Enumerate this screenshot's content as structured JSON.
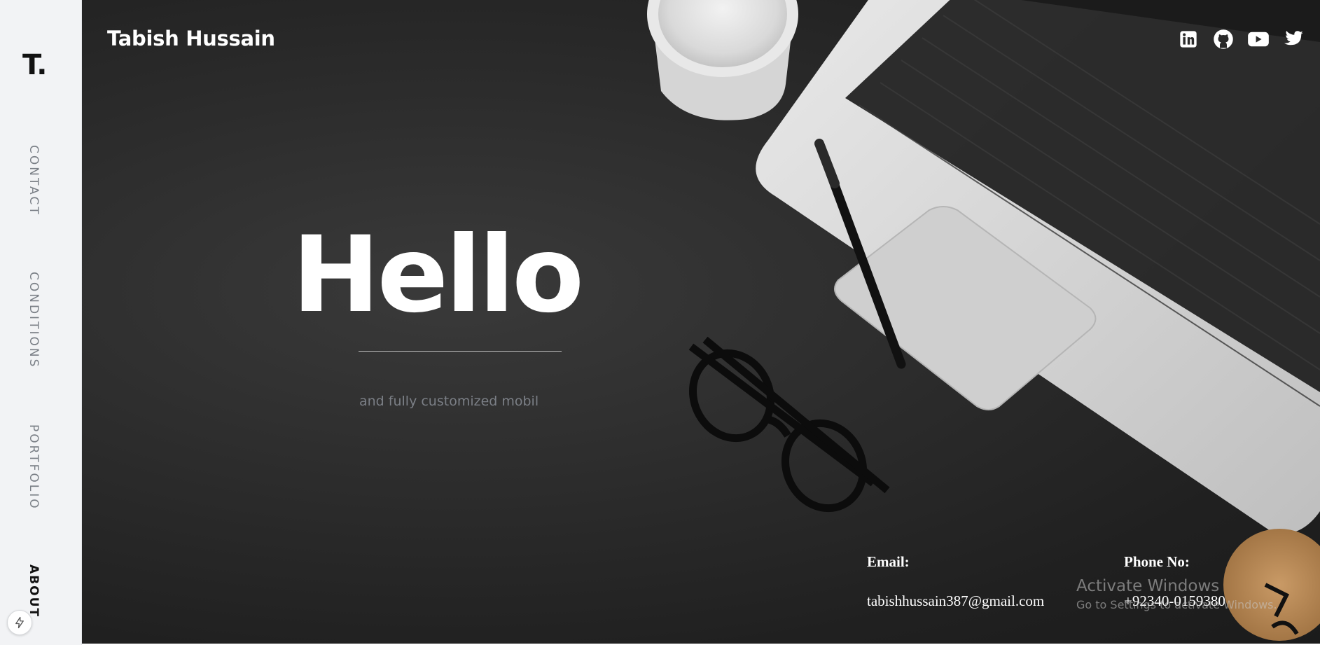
{
  "sidebar": {
    "brand": "T.",
    "nav": [
      {
        "label": "CONTACT",
        "active": false
      },
      {
        "label": "CONDITIONS",
        "active": false
      },
      {
        "label": "PORTFOLIO",
        "active": false
      },
      {
        "label": "ABOUT",
        "active": true
      }
    ],
    "bottom_button_icon": "bolt-icon"
  },
  "header": {
    "site_name": "Tabish Hussain",
    "social_icons": [
      "linkedin-icon",
      "github-icon",
      "youtube-icon",
      "twitter-icon"
    ]
  },
  "hero": {
    "headline": "Hello",
    "subtitle": "and fully customized mobil"
  },
  "contact": {
    "email_label": "Email:",
    "email": "tabishhussain387@gmail.com",
    "phone_label": "Phone No:",
    "phone": "+92340-0159380"
  },
  "overlay": {
    "activate_title": "Activate Windows",
    "activate_sub": "Go to Settings to activate Windows."
  },
  "colors": {
    "sidebar_bg": "#f2f3f5",
    "hero_bg": "#2a2a2a",
    "muted_text": "#7b7f86",
    "white": "#ffffff"
  }
}
